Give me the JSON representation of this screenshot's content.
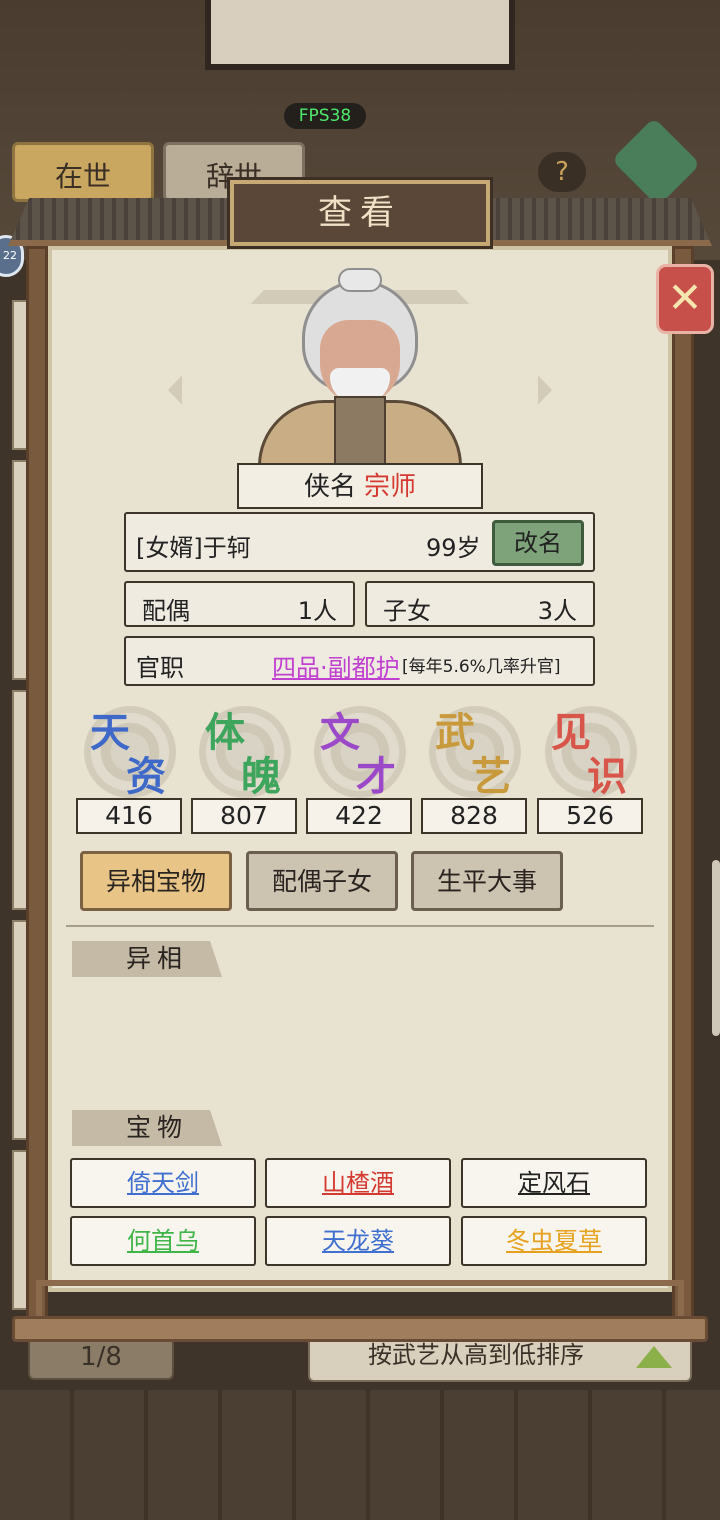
{
  "fps": "FPS38",
  "top_tabs": {
    "alive": "在世",
    "deceased": "辞世"
  },
  "help_label": "?",
  "side_badge": "22",
  "dialog": {
    "title": "查看",
    "close_label": "✕",
    "hero_name_label": "侠名",
    "hero_rank": "宗师",
    "person": "[女婿]于轲",
    "age": "99岁",
    "rename_label": "改名",
    "spouse_label": "配偶",
    "spouse_value": "1人",
    "children_label": "子女",
    "children_value": "3人",
    "office_label": "官职",
    "office_value": "四品·副都护",
    "office_note": "[每年5.6%几率升官]"
  },
  "stats": [
    {
      "c1": "天",
      "c2": "资",
      "value": "416",
      "color": "#3e69c8"
    },
    {
      "c1": "体",
      "c2": "魄",
      "value": "807",
      "color": "#3ea55c"
    },
    {
      "c1": "文",
      "c2": "才",
      "value": "422",
      "color": "#9b49c9"
    },
    {
      "c1": "武",
      "c2": "艺",
      "value": "828",
      "color": "#c99a3b"
    },
    {
      "c1": "见",
      "c2": "识",
      "value": "526",
      "color": "#d8554a"
    }
  ],
  "tabs": {
    "treasures": "异相宝物",
    "family": "配偶子女",
    "events": "生平大事"
  },
  "sections": {
    "aspects": "异相",
    "treasures": "宝物"
  },
  "treasures": [
    {
      "name": "倚天剑",
      "color": "#3f6fcf"
    },
    {
      "name": "山楂酒",
      "color": "#d53a32"
    },
    {
      "name": "定风石",
      "color": "#222222"
    },
    {
      "name": "何首乌",
      "color": "#3fb448"
    },
    {
      "name": "天龙葵",
      "color": "#3f6fcf"
    },
    {
      "name": "冬虫夏草",
      "color": "#e6a21e"
    }
  ],
  "pager": "1/8",
  "sort_label": "按武艺从高到低排序"
}
